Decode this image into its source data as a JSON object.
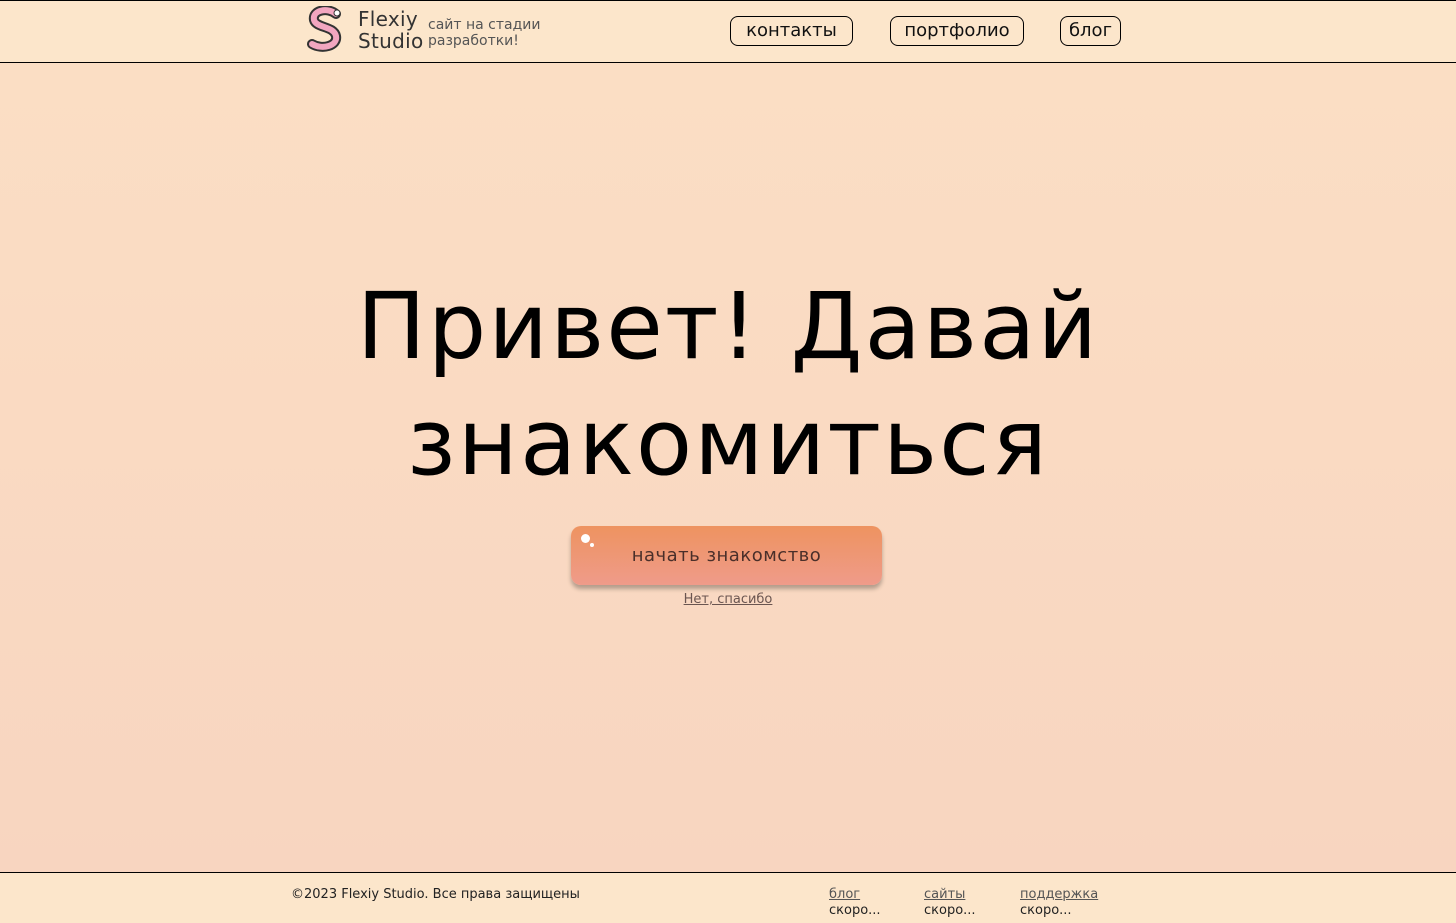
{
  "header": {
    "brand_line1": "Flexiy",
    "brand_line2": "Studio",
    "tagline_line1": "сайт на стадии",
    "tagline_line2": "разработки!",
    "nav": {
      "contacts": "контакты",
      "portfolio": "портфолио",
      "blog": "блог"
    }
  },
  "hero": {
    "title_line1": "Привет! Давай",
    "title_line2": "знакомиться",
    "cta_label": "начать знакомство",
    "decline_label": "Нет, спасибо"
  },
  "footer": {
    "copyright": "©2023 Flexiy Studio. Все права защищены",
    "columns": [
      {
        "title": "блог",
        "note": "скоро..."
      },
      {
        "title": "сайты",
        "note": "скоро..."
      },
      {
        "title": "поддержка",
        "note": "скоро..."
      }
    ]
  },
  "colors": {
    "header_bg": "#fce6cb",
    "main_bg": "#f9d9c0",
    "cta_top": "#ee9360",
    "cta_bottom": "#ef9b8a",
    "logo_pink": "#f2a6c0"
  },
  "icons": {
    "logo": "flexiy-s-logo-icon",
    "cta_decoration": "bubble-dots-icon"
  }
}
